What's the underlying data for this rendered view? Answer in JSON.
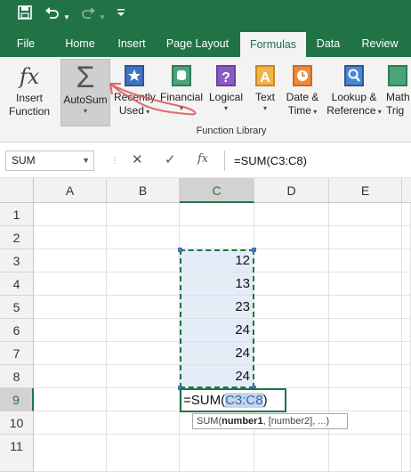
{
  "quick_access": {
    "save_icon": "save-icon",
    "undo_icon": "undo-icon",
    "redo_icon": "redo-icon",
    "customize_icon": "customize-icon"
  },
  "tabs": [
    {
      "label": "File",
      "active": false
    },
    {
      "label": "Home",
      "active": false
    },
    {
      "label": "Insert",
      "active": false
    },
    {
      "label": "Page Layout",
      "active": false
    },
    {
      "label": "Formulas",
      "active": true
    },
    {
      "label": "Data",
      "active": false
    },
    {
      "label": "Review",
      "active": false
    }
  ],
  "ribbon": {
    "buttons": [
      {
        "line1": "Insert",
        "line2": "Function",
        "icon": "insert-function-icon",
        "symbol": "fx"
      },
      {
        "line1": "AutoSum",
        "line2": "",
        "icon": "autosum-icon",
        "symbol": "Σ",
        "dropdown": true
      },
      {
        "line1": "Recently",
        "line2": "Used",
        "icon": "star-book-icon",
        "dropdown": true
      },
      {
        "line1": "Financial",
        "line2": "",
        "icon": "financial-icon",
        "dropdown": true
      },
      {
        "line1": "Logical",
        "line2": "",
        "icon": "logical-icon",
        "symbol": "?",
        "dropdown": true
      },
      {
        "line1": "Text",
        "line2": "",
        "icon": "text-icon",
        "symbol": "A",
        "dropdown": true
      },
      {
        "line1": "Date &",
        "line2": "Time",
        "icon": "date-time-icon",
        "dropdown": true
      },
      {
        "line1": "Lookup &",
        "line2": "Reference",
        "icon": "lookup-icon",
        "dropdown": true
      },
      {
        "line1": "Math",
        "line2": "Trig",
        "icon": "math-trig-icon",
        "symbol": "θ",
        "dropdown": true
      }
    ],
    "group_label": "Function Library"
  },
  "formula_bar": {
    "name_box": "SUM",
    "cancel_symbol": "✕",
    "enter_symbol": "✓",
    "fx_symbol": "fx",
    "formula": "=SUM(C3:C8)"
  },
  "columns": [
    "A",
    "B",
    "C",
    "D",
    "E"
  ],
  "selected_column": "C",
  "rows": [
    "1",
    "2",
    "3",
    "4",
    "5",
    "6",
    "7",
    "8",
    "9",
    "10",
    "11"
  ],
  "selected_row": "9",
  "column_c_values": [
    "",
    "",
    "12",
    "13",
    "23",
    "24",
    "24",
    "24"
  ],
  "edit_cell": {
    "prefix": "=SUM(",
    "ref": "C3:C8",
    "suffix": ")"
  },
  "tooltip": {
    "fn": "SUM(",
    "arg1": "number1",
    "rest": ", [number2], ...)"
  }
}
